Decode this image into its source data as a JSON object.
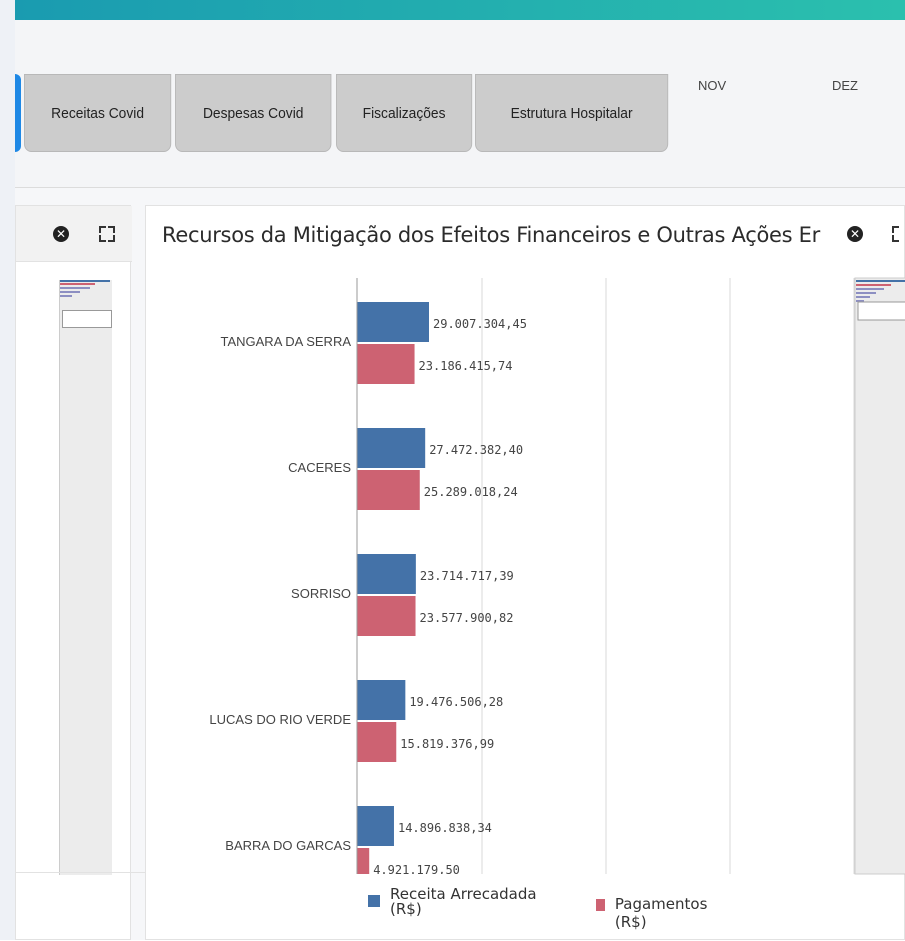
{
  "tabs": [
    {
      "label": "Receitas Covid"
    },
    {
      "label": "Despesas Covid"
    },
    {
      "label": "Fiscalizações"
    },
    {
      "label": "Estrutura Hospitalar"
    }
  ],
  "months": [
    "NOV",
    "DEZ"
  ],
  "main_panel": {
    "title": "Recursos da Mitigação dos Efeitos Financeiros e Outras Ações Er"
  },
  "colors": {
    "receita": "#4472a8",
    "pagamentos": "#cd6272",
    "tab": "#cccccc",
    "active_tab_edge": "#1e88e5",
    "topbar_start": "#1a9bb0",
    "topbar_end": "#2bc0ae"
  },
  "icons": {
    "close": "close-circle-icon",
    "expand": "expand-icon"
  },
  "chart_data": {
    "type": "bar",
    "orientation": "horizontal",
    "categories": [
      "TANGARA DA SERRA",
      "CACERES",
      "SORRISO",
      "LUCAS DO RIO VERDE",
      "BARRA DO GARCAS"
    ],
    "series": [
      {
        "name": "Receita Arrecadada (R$)",
        "values": [
          29007304.45,
          27472382.4,
          23714717.39,
          19476506.28,
          14896838.34
        ],
        "labels": [
          "29.007.304,45",
          "27.472.382,40",
          "23.714.717,39",
          "19.476.506,28",
          "14.896.838,34"
        ]
      },
      {
        "name": "Pagamentos (R$)",
        "values": [
          23186415.74,
          25289018.24,
          23577900.82,
          15819376.99,
          4921179.5
        ],
        "labels": [
          "23.186.415,74",
          "25.289.018,24",
          "23.577.900,82",
          "15.819.376,99",
          "4.921.179,50"
        ]
      }
    ],
    "legend": [
      "Receita Arrecadada (R$)",
      "Pagamentos (R$)"
    ],
    "legend_position": "bottom",
    "grid": true
  }
}
